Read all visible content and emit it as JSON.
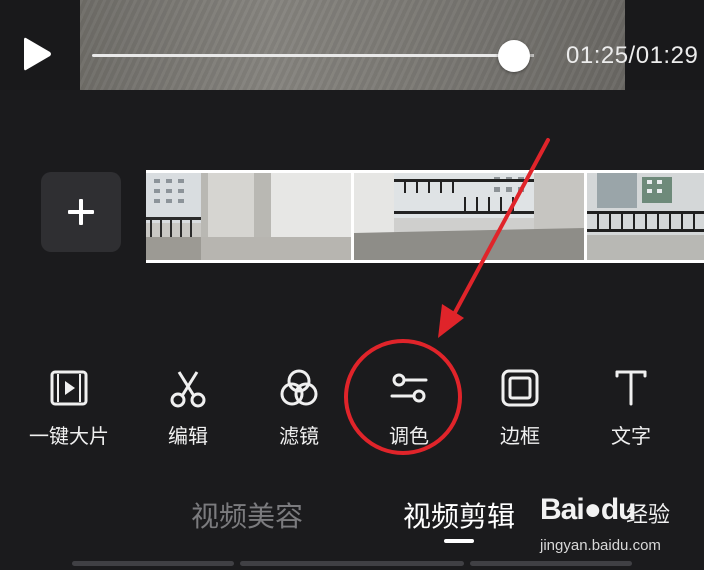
{
  "player": {
    "time": "01:25/01:29",
    "progress_fraction": 0.955
  },
  "timeline": {
    "add_label": "+"
  },
  "tools": [
    {
      "label": "一键大片",
      "icon": "film-play-icon"
    },
    {
      "label": "编辑",
      "icon": "scissors-icon"
    },
    {
      "label": "滤镜",
      "icon": "filter-circles-icon"
    },
    {
      "label": "调色",
      "icon": "sliders-icon"
    },
    {
      "label": "边框",
      "icon": "frame-icon"
    },
    {
      "label": "文字",
      "icon": "text-icon"
    }
  ],
  "tabs": [
    {
      "label": "视频美容",
      "active": false
    },
    {
      "label": "视频剪辑",
      "active": true
    }
  ],
  "watermark": {
    "logo": "Bai",
    "logo_tail": "du",
    "cn": "经验",
    "url": "jingyan.baidu.com"
  },
  "annotation": {
    "highlight_color": "#e0242a"
  }
}
